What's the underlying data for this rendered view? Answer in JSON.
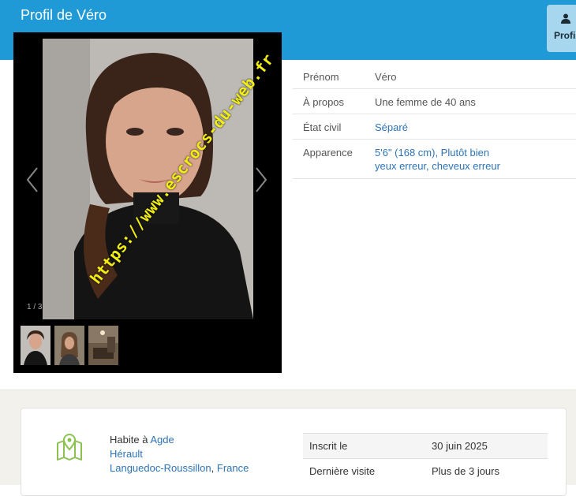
{
  "header": {
    "title": "Profil de Véro",
    "tab_label": "Profil",
    "tab_icon": "user-icon",
    "bg": "#1f9ad6"
  },
  "gallery": {
    "counter": "1 / 3",
    "watermark": "https://www.escrocs-du-web.fr",
    "prev_icon": "chevron-left-icon",
    "next_icon": "chevron-right-icon",
    "thumbnail_count": 3
  },
  "profile": [
    {
      "label": "Prénom",
      "value": "Véro",
      "link": false
    },
    {
      "label": "À propos",
      "value": "Une femme de 40 ans",
      "link": false
    },
    {
      "label": "État civil",
      "value": "Séparé",
      "link": true
    },
    {
      "label": "Apparence",
      "value_line1": "5'6\" (168 cm), Plutôt bien",
      "value_line2": "yeux erreur, cheveux erreur",
      "link": true
    }
  ],
  "location": {
    "prefix": "Habite à ",
    "city": "Agde",
    "department": "Hérault",
    "region": "Languedoc-Roussillon",
    "separator": ", ",
    "country": "France",
    "icon": "map-pin-icon"
  },
  "stats": [
    {
      "label": "Inscrit le",
      "value": "30 juin 2025"
    },
    {
      "label": "Dernière visite",
      "value": "Plus de 3 jours"
    }
  ],
  "colors": {
    "accent": "#1f9ad6",
    "link": "#2e74b5",
    "map_icon": "#8cc152",
    "watermark": "#f1ee14"
  }
}
